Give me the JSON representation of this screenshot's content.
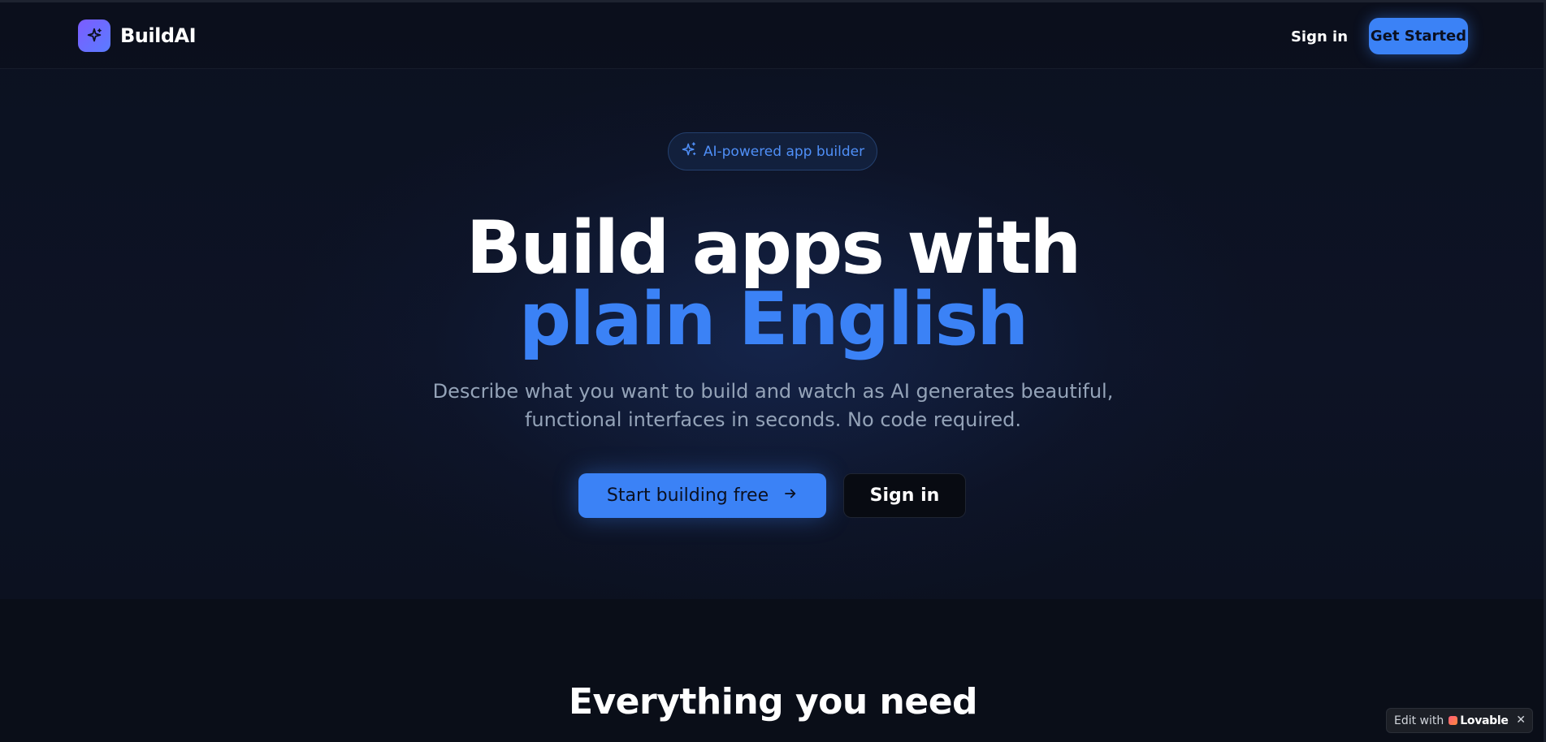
{
  "header": {
    "brand": "BuildAI",
    "signin_label": "Sign in",
    "get_started_label": "Get Started"
  },
  "hero": {
    "badge_label": "AI-powered app builder",
    "title_line1": "Build apps with",
    "title_line2": "plain English",
    "subtitle_line1": "Describe what you want to build and watch as AI generates beautiful,",
    "subtitle_line2": "functional interfaces in seconds. No code required.",
    "cta_primary_label": "Start building free",
    "cta_secondary_label": "Sign in"
  },
  "features": {
    "section_title": "Everything you need"
  },
  "lovable_badge": {
    "prefix": "Edit with",
    "brand": "Lovable",
    "close_glyph": "✕"
  },
  "colors": {
    "accent": "#3b82f6",
    "background": "#0b0f1a",
    "muted_text": "#94a3b8"
  },
  "icons": {
    "logo": "sparkles-icon",
    "badge": "sparkles-icon",
    "cta_arrow": "arrow-right-icon",
    "lovable": "heart-icon"
  }
}
